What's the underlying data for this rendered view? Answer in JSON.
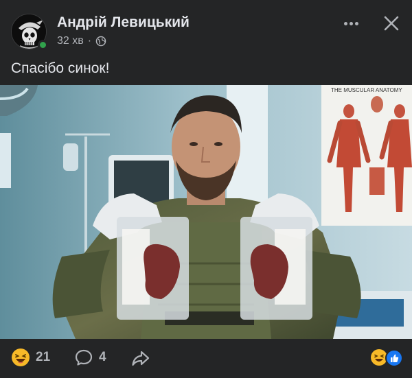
{
  "post": {
    "author": "Андрій Левицький",
    "time": "32 хв",
    "separator": "·",
    "caption": "Спасібо синок!"
  },
  "header": {
    "avatar_icon": "skull-avatar-icon",
    "privacy_icon": "globe-icon",
    "more_icon": "more-options-icon",
    "close_icon": "close-icon",
    "online_status_color": "#31a24c"
  },
  "footer": {
    "reaction_count": "21",
    "comment_count": "4",
    "reaction_icon": "laughing-emoji-icon",
    "comment_icon": "comment-bubble-icon",
    "share_icon": "share-arrow-icon",
    "summary_icons": [
      "laughing-emoji-icon",
      "like-thumb-icon"
    ],
    "accent_like": "#1877f2"
  },
  "photo": {
    "poster_title": "THE MUSCULAR ANATOMY"
  }
}
